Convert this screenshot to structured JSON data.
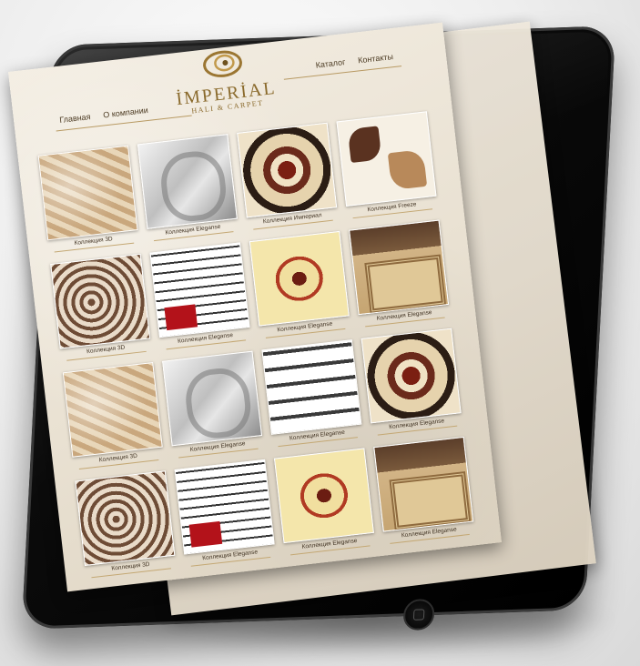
{
  "site": {
    "logo": {
      "name": "İMPERİAL",
      "subtitle": "HALI & CARPET"
    },
    "nav_left": [
      "Главная",
      "О компании"
    ],
    "nav_right": [
      "Каталог",
      "Контакты"
    ]
  },
  "catalog": [
    {
      "caption": "Коллекция 3D",
      "style": "rug-3d"
    },
    {
      "caption": "Коллекция Eleganse",
      "style": "rug-elegance"
    },
    {
      "caption": "Коллекция Империал",
      "style": "rug-medallion"
    },
    {
      "caption": "Коллекция Freeze",
      "style": "rug-freeze"
    },
    {
      "caption": "Коллекция 3D",
      "style": "rug-brown"
    },
    {
      "caption": "Коллекция Eleganse",
      "style": "rug-squares"
    },
    {
      "caption": "Коллекция Eleganse",
      "style": "rug-gold"
    },
    {
      "caption": "Коллекция Eleganse",
      "style": "rug-room"
    },
    {
      "caption": "Коллекция 3D",
      "style": "rug-3d"
    },
    {
      "caption": "Коллекция Eleganse",
      "style": "rug-elegance"
    },
    {
      "caption": "Коллекция Eleganse",
      "style": "rug-swirl"
    },
    {
      "caption": "Коллекция Eleganse",
      "style": "rug-medallion"
    },
    {
      "caption": "Коллекция 3D",
      "style": "rug-brown"
    },
    {
      "caption": "Коллекция Eleganse",
      "style": "rug-squares"
    },
    {
      "caption": "Коллекция Eleganse",
      "style": "rug-gold"
    },
    {
      "caption": "Коллекция Eleganse",
      "style": "rug-room"
    }
  ],
  "colors": {
    "accent_gold": "#8a6a2c",
    "paper": "#ebe3d4",
    "tablet": "#0b0b0b"
  },
  "icons": [
    "logo-swirl-icon",
    "camera-icon",
    "home-button-icon"
  ]
}
